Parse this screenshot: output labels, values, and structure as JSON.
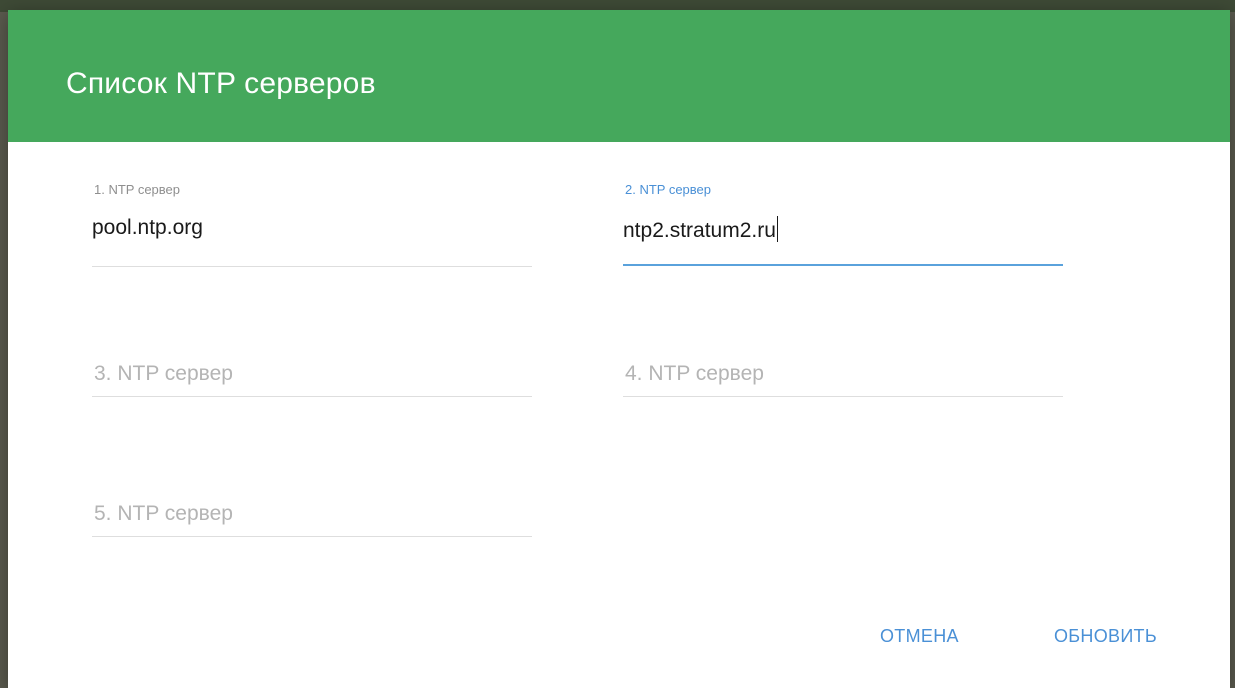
{
  "dialog": {
    "title": "Список NTP серверов",
    "header_color": "#45a85c"
  },
  "fields": [
    {
      "label": "1. NTP сервер",
      "value": "pool.ntp.org",
      "placeholder": "",
      "focused": false
    },
    {
      "label": "2. NTP сервер",
      "value": "ntp2.stratum2.ru",
      "placeholder": "",
      "focused": true
    },
    {
      "label": "",
      "value": "",
      "placeholder": "3. NTP сервер",
      "focused": false
    },
    {
      "label": "",
      "value": "",
      "placeholder": "4. NTP сервер",
      "focused": false
    },
    {
      "label": "",
      "value": "",
      "placeholder": "5. NTP сервер",
      "focused": false
    }
  ],
  "actions": {
    "cancel_label": "ОТМЕНА",
    "update_label": "ОБНОВИТЬ",
    "accent_color": "#4a90d6"
  }
}
